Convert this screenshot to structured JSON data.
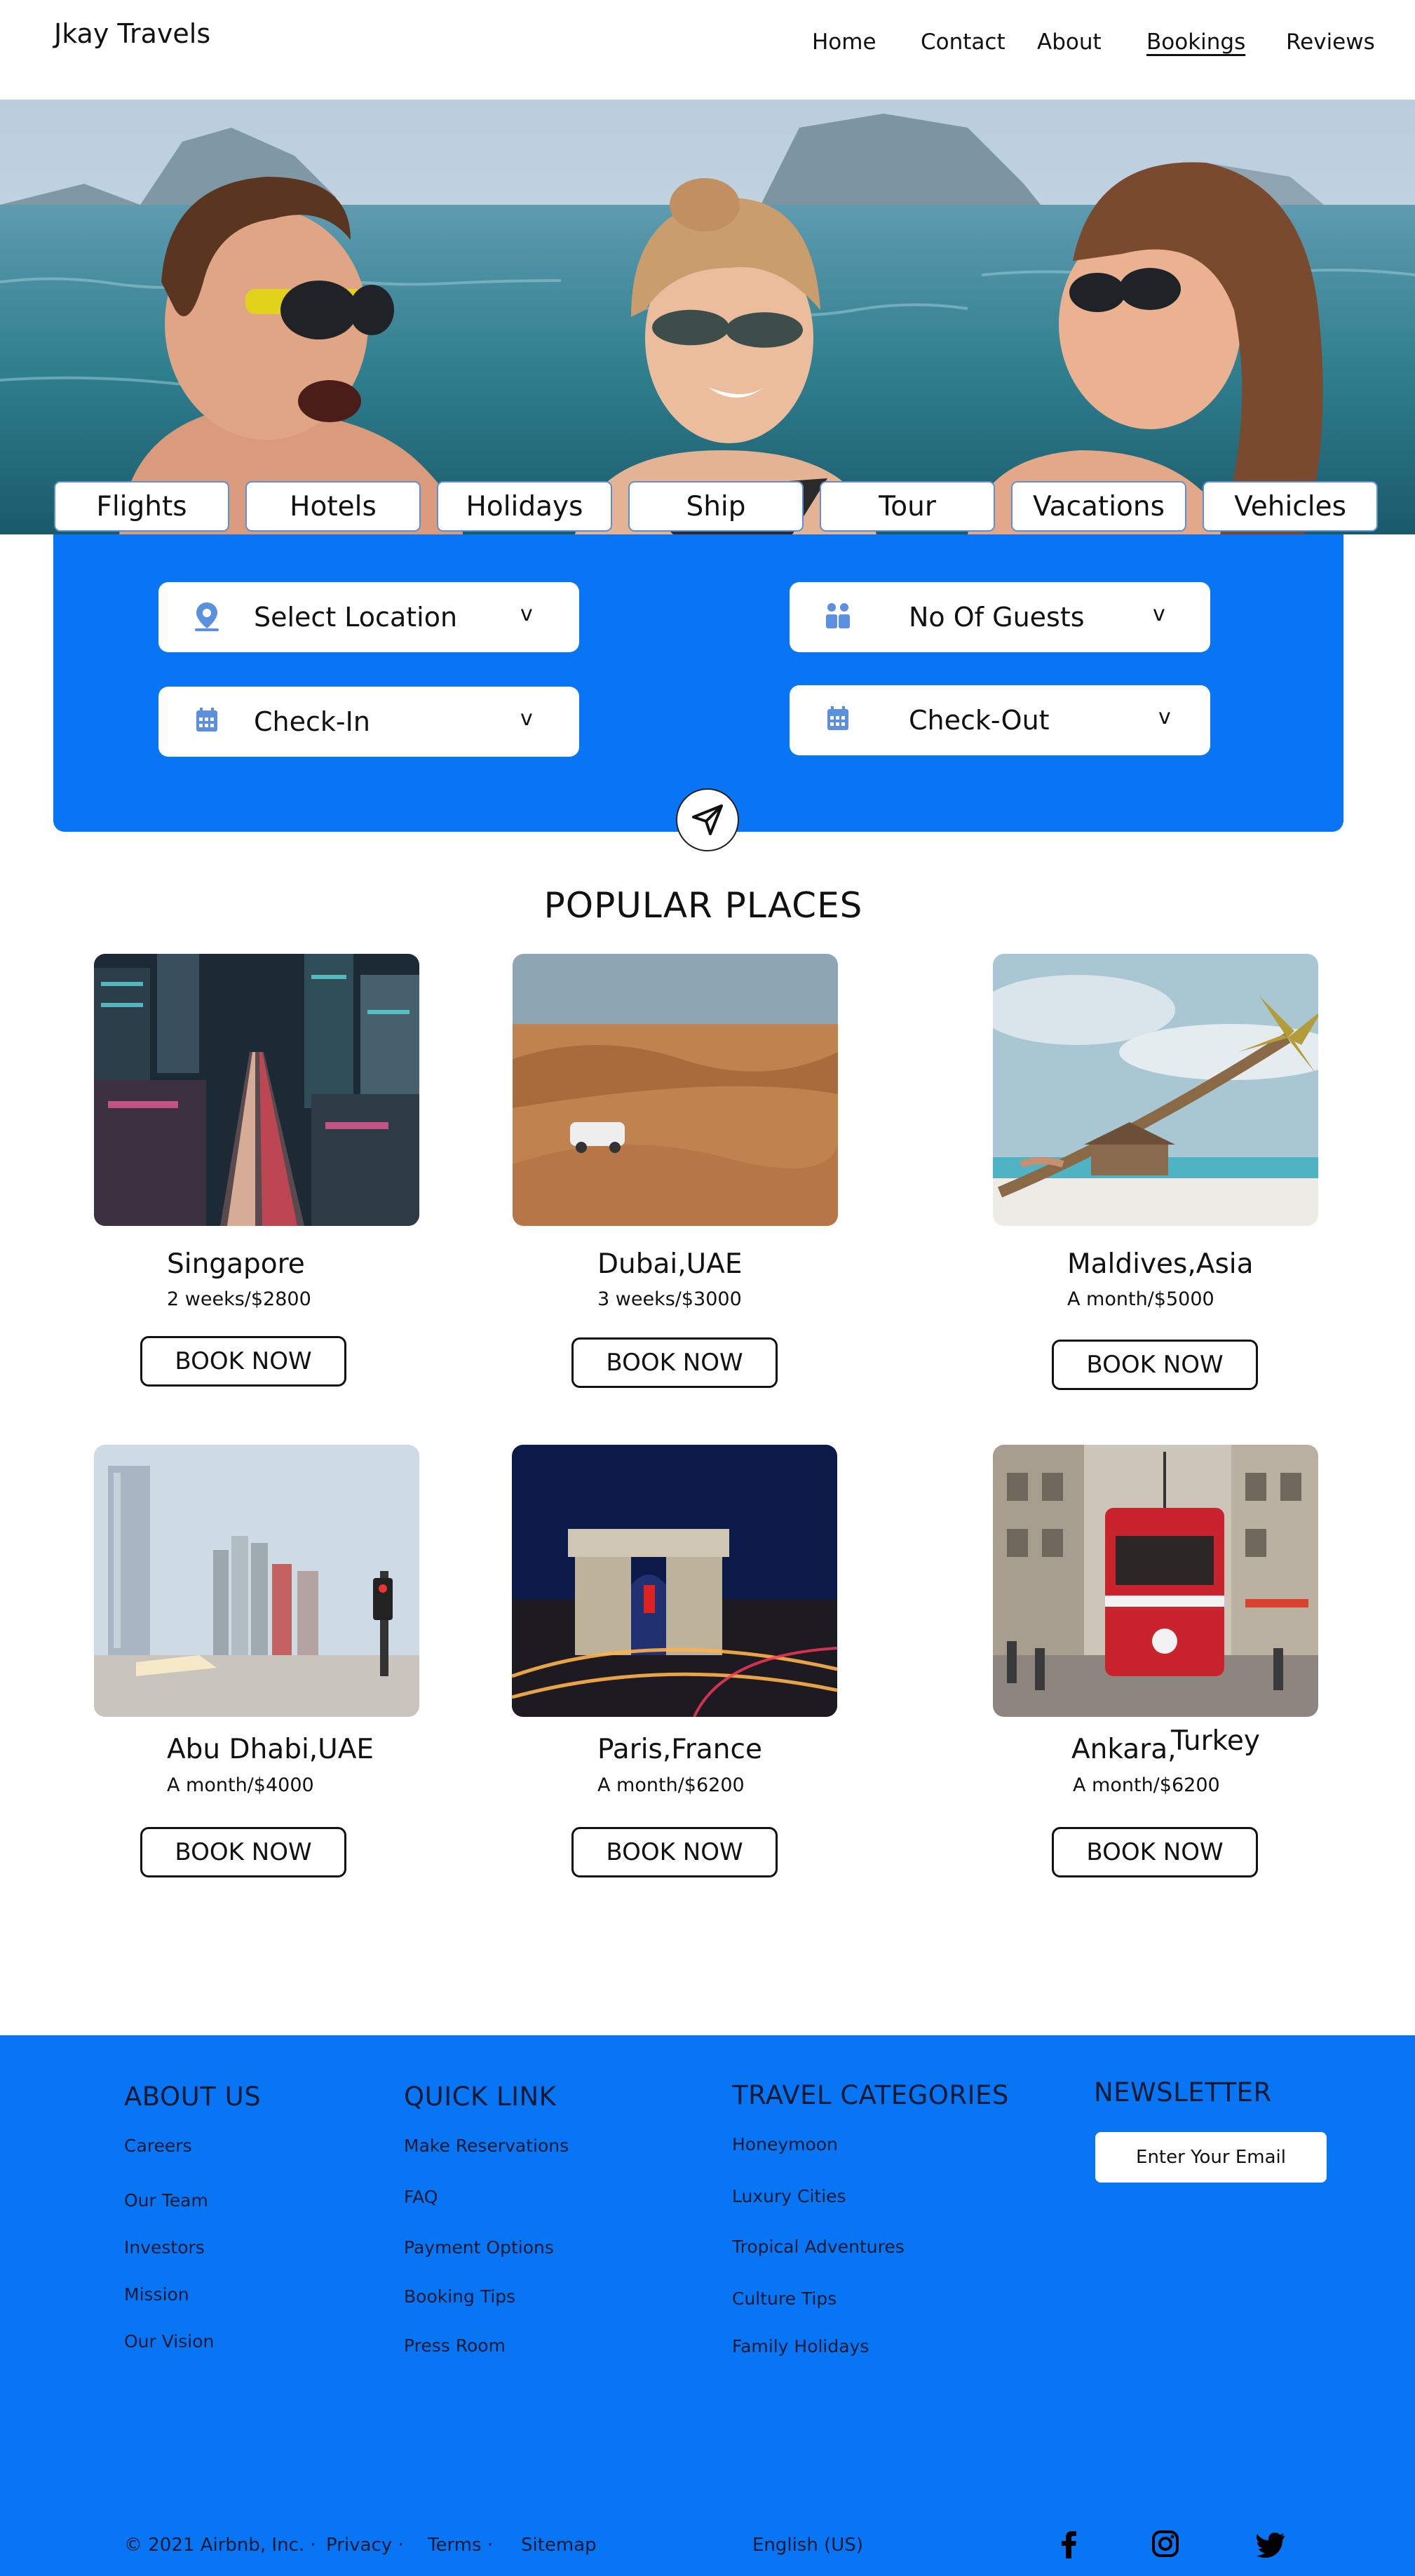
{
  "header": {
    "brand": "Jkay Travels",
    "nav": [
      "Home",
      "Contact",
      "About",
      "Bookings",
      "Reviews"
    ],
    "active": "Bookings"
  },
  "tabs": [
    "Flights",
    "Hotels",
    "Holidays",
    "Ship",
    "Tour",
    "Vacations",
    "Vehicles"
  ],
  "search": {
    "location": "Select Location",
    "guests": "No Of Guests",
    "checkin": "Check-In",
    "checkout": "Check-Out",
    "chevron": "v",
    "icons": [
      "location-pin-icon",
      "guests-icon",
      "calendar-icon",
      "send-icon"
    ]
  },
  "popular": {
    "title": "POPULAR PLACES",
    "book_label": "BOOK NOW",
    "places": [
      {
        "name": "Singapore",
        "price": "2 weeks/$2800"
      },
      {
        "name": "Dubai,UAE",
        "price": "3 weeks/$3000"
      },
      {
        "name": "Maldives,Asia",
        "price": "A month/$5000"
      },
      {
        "name": "Abu Dhabi,UAE",
        "price": "A month/$4000"
      },
      {
        "name": "Paris,France",
        "price": "A month/$6200"
      },
      {
        "name": "Ankara,",
        "name_extra": "Turkey",
        "price": "A month/$6200"
      }
    ]
  },
  "footer": {
    "about": {
      "title": "ABOUT US",
      "links": [
        "Careers",
        "Our Team",
        "Investors",
        "Mission",
        "Our Vision"
      ]
    },
    "quick": {
      "title": "QUICK LINK",
      "links": [
        "Make Reservations",
        "FAQ",
        "Payment Options",
        "Booking Tips",
        "Press Room"
      ]
    },
    "categories": {
      "title": "TRAVEL CATEGORIES",
      "links": [
        "Honeymoon",
        "Luxury Cities",
        "Tropical Adventures",
        "Culture Tips",
        "Family Holidays"
      ]
    },
    "newsletter": {
      "title": "NEWSLETTER",
      "placeholder": "Enter Your Email"
    },
    "bottom": {
      "copyright": "© 2021 Airbnb, Inc. ·",
      "privacy": "Privacy ·",
      "terms": "Terms ·",
      "sitemap": "Sitemap",
      "language": "English (US)"
    },
    "social": [
      "facebook-icon",
      "instagram-icon",
      "twitter-icon"
    ]
  },
  "colors": {
    "primary": "#0775f4",
    "text": "#0b1a33"
  }
}
